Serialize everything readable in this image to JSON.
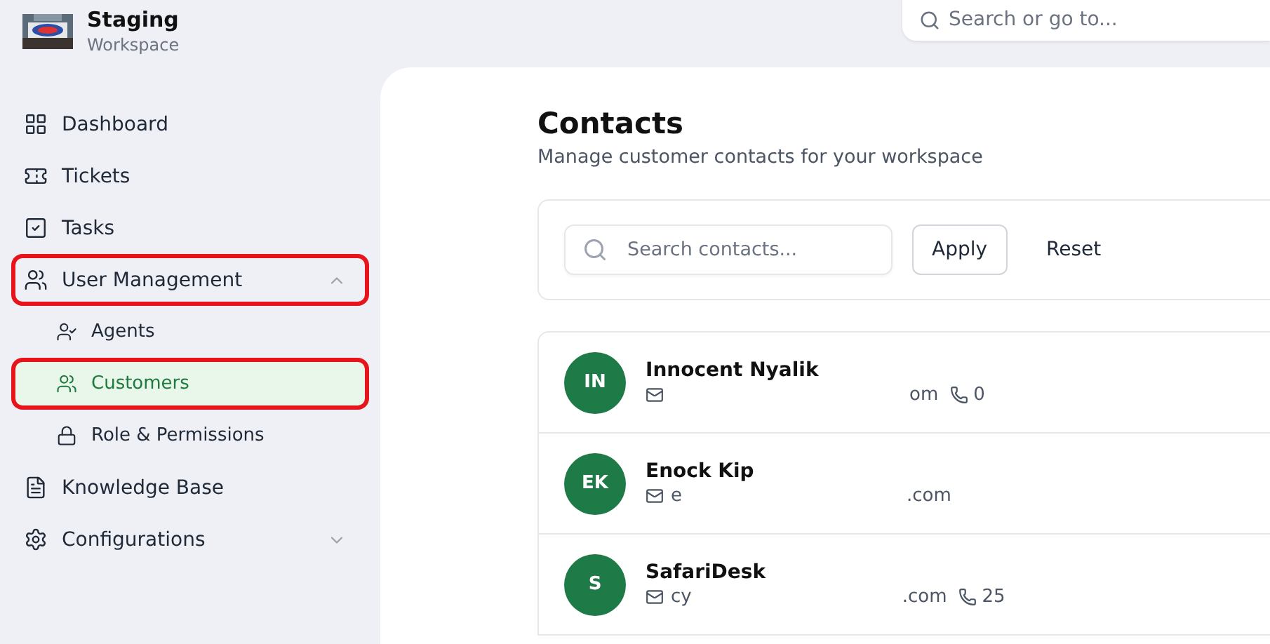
{
  "workspace": {
    "name": "Staging",
    "subtitle": "Workspace"
  },
  "top_search": {
    "placeholder": "Search or go to..."
  },
  "sidebar": {
    "items": [
      {
        "label": "Dashboard",
        "selected": false,
        "outlined": false
      },
      {
        "label": "Tickets",
        "selected": false,
        "outlined": false
      },
      {
        "label": "Tasks",
        "selected": false,
        "outlined": false
      },
      {
        "label": "User Management",
        "selected": false,
        "outlined": true,
        "expanded": true,
        "children": [
          {
            "label": "Agents",
            "selected": false,
            "outlined": false
          },
          {
            "label": "Customers",
            "selected": true,
            "outlined": true
          },
          {
            "label": "Role & Permissions",
            "selected": false,
            "outlined": false
          }
        ]
      },
      {
        "label": "Knowledge Base",
        "selected": false,
        "outlined": false
      },
      {
        "label": "Configurations",
        "selected": false,
        "outlined": false,
        "expanded": false
      }
    ]
  },
  "page": {
    "title": "Contacts",
    "subtitle": "Manage customer contacts for your workspace"
  },
  "filter": {
    "placeholder": "Search contacts...",
    "buttons": [
      {
        "label": "Apply",
        "kind": "outline"
      },
      {
        "label": "Reset",
        "kind": "text"
      }
    ]
  },
  "contacts": [
    {
      "initials": "IN",
      "name": "Innocent Nyalik",
      "email_end": "om",
      "phone": "0"
    },
    {
      "initials": "EK",
      "name": "Enock Kip",
      "email_start": "e",
      "email_end": ".com"
    },
    {
      "initials": "S",
      "name": "SafariDesk",
      "email_start": "cy",
      "email_end": ".com",
      "phone": "25"
    }
  ]
}
